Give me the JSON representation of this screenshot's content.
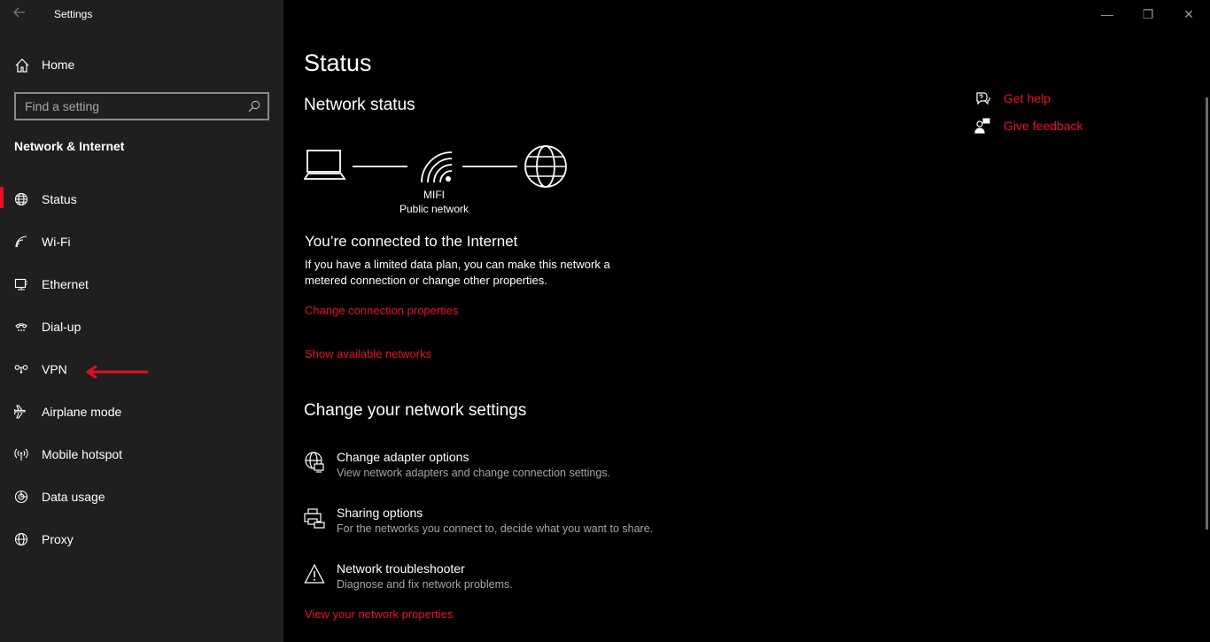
{
  "window": {
    "title": "Settings",
    "controls": {
      "minimize": "—",
      "maximize": "❐",
      "close": "✕"
    }
  },
  "sidebar": {
    "home_label": "Home",
    "search_placeholder": "Find a setting",
    "section_title": "Network & Internet",
    "items": [
      {
        "label": "Status",
        "icon": "status-globe-icon",
        "active": true
      },
      {
        "label": "Wi-Fi",
        "icon": "wifi-icon"
      },
      {
        "label": "Ethernet",
        "icon": "ethernet-icon"
      },
      {
        "label": "Dial-up",
        "icon": "dialup-icon"
      },
      {
        "label": "VPN",
        "icon": "vpn-icon"
      },
      {
        "label": "Airplane mode",
        "icon": "airplane-icon"
      },
      {
        "label": "Mobile hotspot",
        "icon": "hotspot-icon"
      },
      {
        "label": "Data usage",
        "icon": "data-usage-icon"
      },
      {
        "label": "Proxy",
        "icon": "proxy-globe-icon"
      }
    ]
  },
  "main": {
    "title": "Status",
    "network_status_title": "Network status",
    "network": {
      "ssid": "MIFI",
      "type": "Public network"
    },
    "connected_title": "You’re connected to the Internet",
    "connected_desc_line1": "If you have a limited data plan, you can make this network a",
    "connected_desc_line2": "metered connection or change other properties.",
    "change_connection_link": "Change connection properties",
    "show_networks_link": "Show available networks",
    "change_settings_title": "Change your network settings",
    "options": [
      {
        "title": "Change adapter options",
        "desc": "View network adapters and change connection settings.",
        "icon": "adapter-icon"
      },
      {
        "title": "Sharing options",
        "desc": "For the networks you connect to, decide what you want to share.",
        "icon": "sharing-icon"
      },
      {
        "title": "Network troubleshooter",
        "desc": "Diagnose and fix network problems.",
        "icon": "warning-icon"
      }
    ],
    "view_properties_link": "View your network properties"
  },
  "help": {
    "get_help": "Get help",
    "give_feedback": "Give feedback"
  },
  "colors": {
    "accent": "#e81123",
    "sidebar_bg": "#1f1f1f",
    "main_bg": "#000000"
  }
}
